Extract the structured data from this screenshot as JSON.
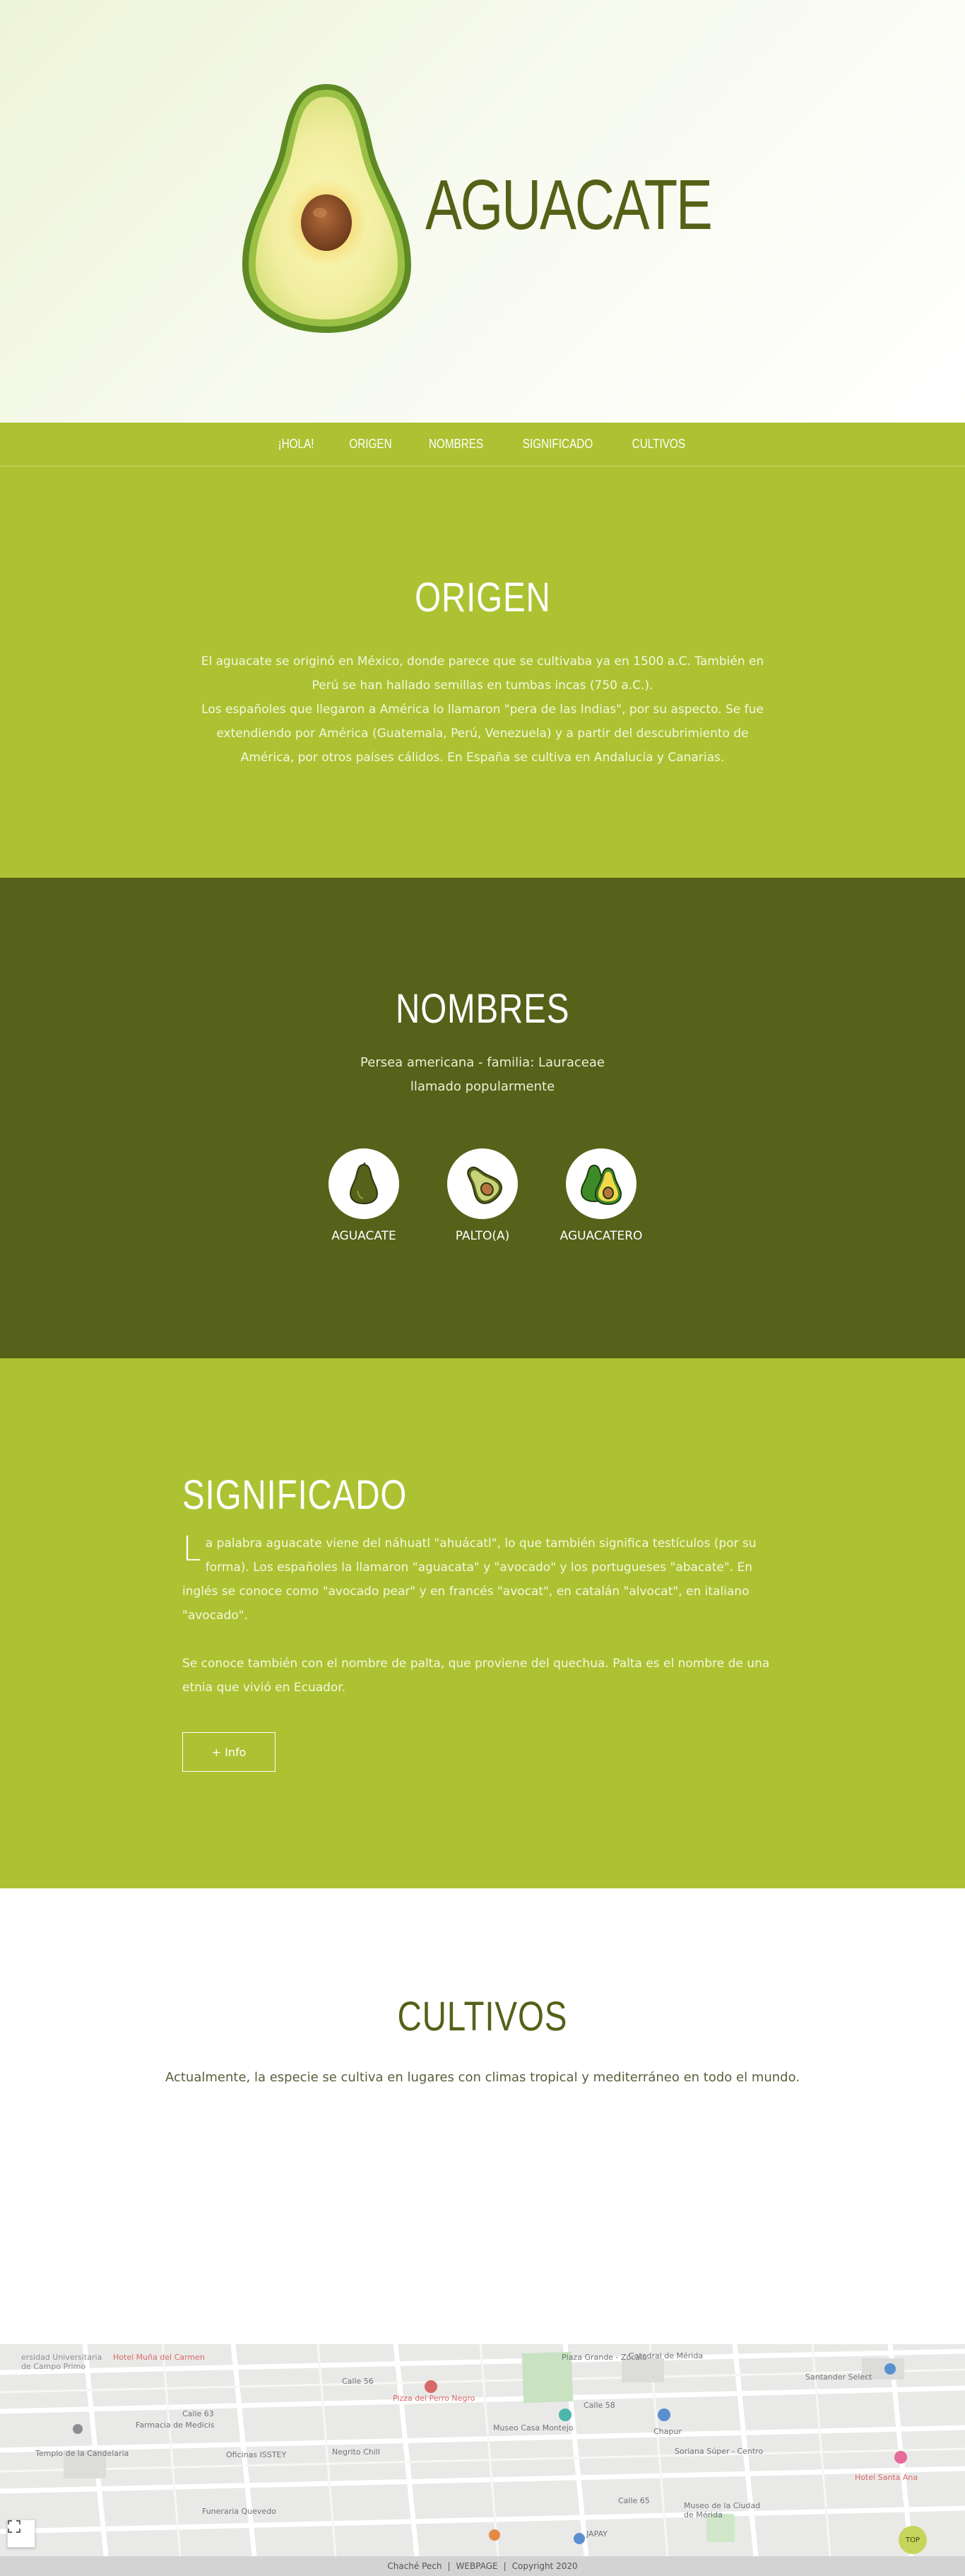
{
  "hero": {
    "title": "AGUACATE",
    "image": "avocado-half-illustration"
  },
  "nav": {
    "items": [
      {
        "label": "¡HOLA!"
      },
      {
        "label": "ORIGEN"
      },
      {
        "label": "NOMBRES"
      },
      {
        "label": "SIGNIFICADO"
      },
      {
        "label": "CULTIVOS"
      }
    ]
  },
  "origen": {
    "heading": "ORIGEN",
    "line1": "El aguacate se originó en México, donde parece que se cultivaba ya en 1500 a.C. También en",
    "line2": "Perú se han hallado semillas en tumbas incas (750 a.C.).",
    "line3": "Los españoles que llegaron a América lo llamaron \"pera de las Indias\", por su aspecto. Se fue",
    "line4": "extendiendo por América (Guatemala, Perú, Venezuela) y a partir del descubrimiento de",
    "line5": "América, por otros países cálidos. En España se cultiva en Andalucía y Canarias."
  },
  "nombres": {
    "heading": "NOMBRES",
    "sub1": "Persea americana - familia: Lauraceae",
    "sub2": "llamado popularmente",
    "cards": [
      {
        "label": "AGUACATE",
        "icon": "whole-avocado-icon"
      },
      {
        "label": "PALTO(A)",
        "icon": "half-avocado-icon"
      },
      {
        "label": "AGUACATERO",
        "icon": "two-avocados-icon"
      }
    ]
  },
  "significado": {
    "heading": "SIGNIFICADO",
    "dropcap": "L",
    "p1": "a palabra aguacate viene del náhuatl \"ahuácatl\", lo que también significa testículos (por su forma). Los españoles la llamaron \"aguacata\" y \"avocado\" y los portugueses \"abacate\". En inglés se conoce como \"avocado pear\" y en francés \"avocat\", en catalán \"alvocat\", en italiano \"avocado\".",
    "p2": "Se conoce también con el nombre de palta, que proviene del quechua. Palta es el nombre de una etnia que vivió en Ecuador.",
    "button": "+ Info"
  },
  "cultivos": {
    "heading": "CULTIVOS",
    "text": "Actualmente, la especie se cultiva en lugares con climas tropical y mediterráneo en todo el mundo."
  },
  "map": {
    "labels": {
      "l1": "ersidad Universitaria",
      "l2": "de Campo Primo",
      "l3": "Hotel Muña del Carmen",
      "l4": "Plaza Grande - Zócalo",
      "l5": "Catedral de Mérida",
      "l6": "Pizza del Perro Negro",
      "l7": "Farmacia de Medicis",
      "l8": "Museo Casa Montejo",
      "l9": "Chapur",
      "l10": "Soriana Súper - Centro",
      "l11": "Templo de la Candelaria",
      "l12": "Oficinas ISSTEY",
      "l13": "Negrito Chill",
      "l14": "Funeraria Quevedo",
      "l15": "Museo de la Ciudad de Mérida",
      "l16": "Santander Select",
      "l17": "Hotel Santa Ana",
      "l18": "JAPAY",
      "l19": "Calle 63",
      "l20": "Calle 65",
      "l21": "Calle 58",
      "l22": "Calle 56"
    },
    "top_button": "TOP"
  },
  "footer": {
    "author": "Chaché Pech",
    "sep1": "|",
    "webpage": "WEBPAGE",
    "sep2": "|",
    "copyright": "Copyright  2020"
  },
  "colors": {
    "lime": "#adc232",
    "olive": "#566119",
    "hero_bg": "#eef4d8"
  }
}
